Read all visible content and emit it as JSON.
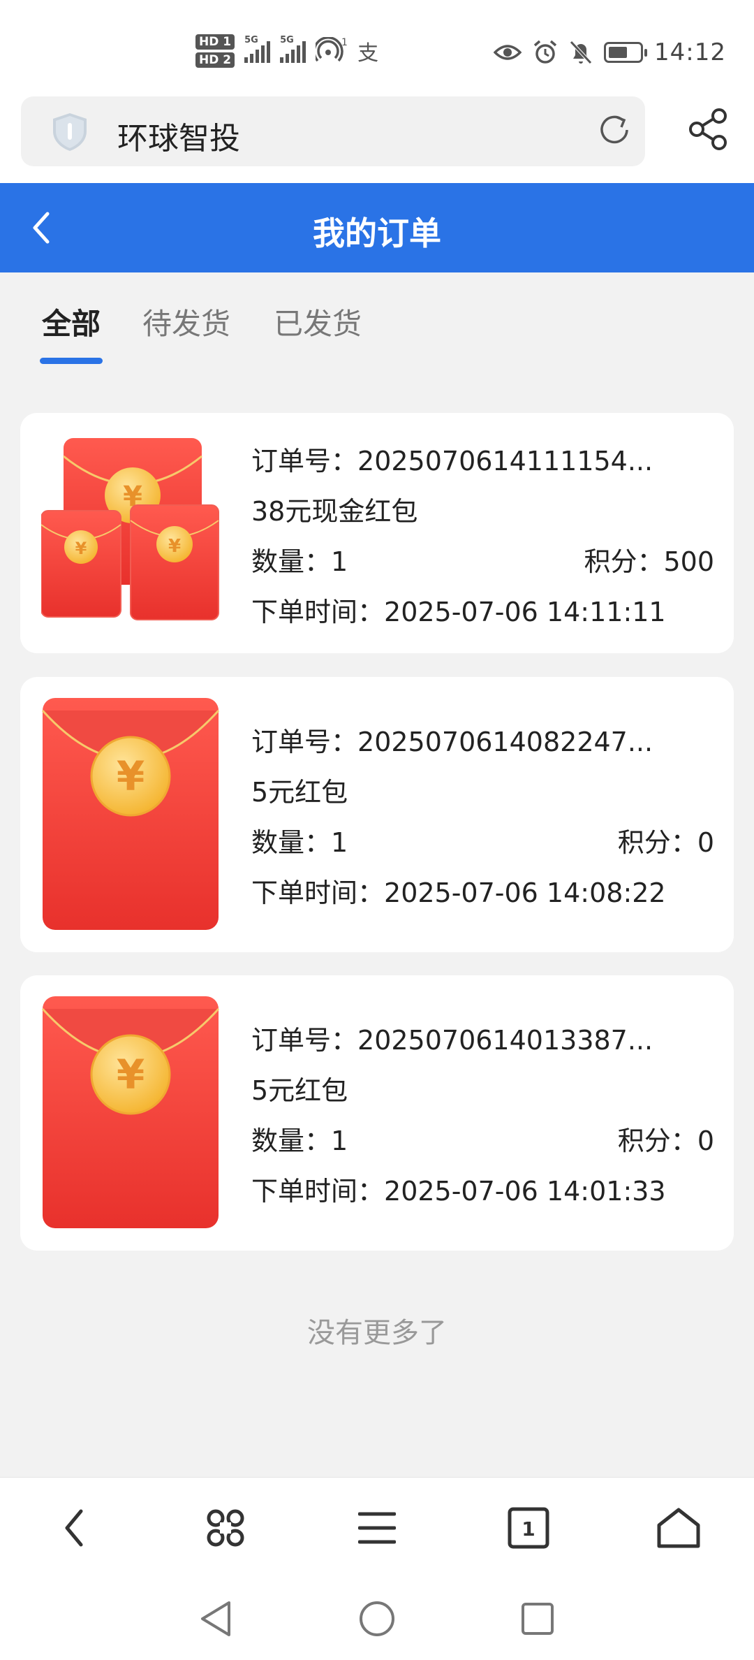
{
  "status_bar": {
    "sim1": "HD 1",
    "sim2": "HD 2",
    "sig_label": "5G",
    "hotspot_sup": "1",
    "alipay_glyph": "支",
    "time": "14:12"
  },
  "browser": {
    "site_title": "环球智投"
  },
  "header": {
    "title": "我的订单"
  },
  "tabs": [
    {
      "label": "全部",
      "active": true
    },
    {
      "label": "待发货",
      "active": false
    },
    {
      "label": "已发货",
      "active": false
    }
  ],
  "labels": {
    "order_no": "订单号：",
    "qty": "数量：",
    "points": "积分：",
    "time": "下单时间："
  },
  "orders": [
    {
      "order_no": "2025070614111154...",
      "product": "38元现金红包",
      "qty": "1",
      "points": "500",
      "time": "2025-07-06 14:11:11",
      "thumb": "multi-red-envelope"
    },
    {
      "order_no": "2025070614082247...",
      "product": "5元红包",
      "qty": "1",
      "points": "0",
      "time": "2025-07-06 14:08:22",
      "thumb": "single-red-envelope"
    },
    {
      "order_no": "2025070614013387...",
      "product": "5元红包",
      "qty": "1",
      "points": "0",
      "time": "2025-07-06 14:01:33",
      "thumb": "single-red-envelope"
    }
  ],
  "footer_note": "没有更多了",
  "bottom_bar_icons": [
    "back-icon",
    "apps-icon",
    "menu-icon",
    "tabs-icon",
    "home-icon"
  ],
  "tab_count": "1",
  "system_nav_icons": [
    "nav-back-icon",
    "nav-home-icon",
    "nav-recents-icon"
  ],
  "colors": {
    "accent": "#2a73e6",
    "envelope": "#f03a35",
    "coin": "#f7c244"
  }
}
